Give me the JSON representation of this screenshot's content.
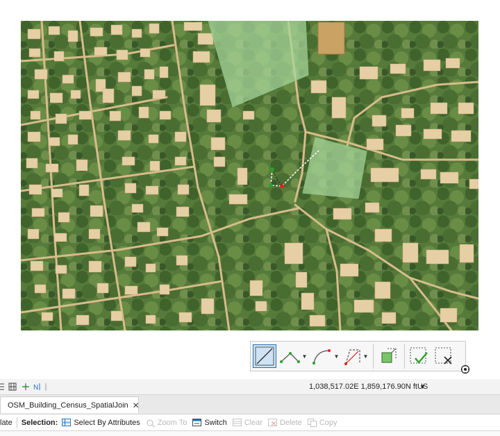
{
  "map": {
    "description_layers": [
      "imagery",
      "building-footprints",
      "parcels",
      "roads"
    ]
  },
  "editing_toolbar": {
    "tools": [
      {
        "name": "line-tool",
        "active": true
      },
      {
        "name": "polyline-tool",
        "has_menu": true
      },
      {
        "name": "arc-tool",
        "has_menu": true
      },
      {
        "name": "right-angle-tool",
        "has_menu": true
      },
      {
        "name": "autocomplete-polygon-tool"
      },
      {
        "name": "finish-sketch-tool"
      },
      {
        "name": "discard-sketch-tool"
      }
    ]
  },
  "status_bar": {
    "coordinates": "1,038,517.02E 1,859,176.90N ftUS"
  },
  "tabs": [
    {
      "label": "OSM_Building_Census_SpatialJoin"
    }
  ],
  "table_toolbar": {
    "partial_label": "late",
    "selection_label": "Selection:",
    "select_by_attributes": "Select By Attributes",
    "zoom_to": "Zoom To",
    "switch": "Switch",
    "clear": "Clear",
    "delete": "Delete",
    "copy": "Copy"
  },
  "colors": {
    "building_fill": "#e6cfa4",
    "road": "#d6b98a",
    "highlight_polygon": "#a9d79c",
    "active_tool": "#1f6fb5"
  }
}
